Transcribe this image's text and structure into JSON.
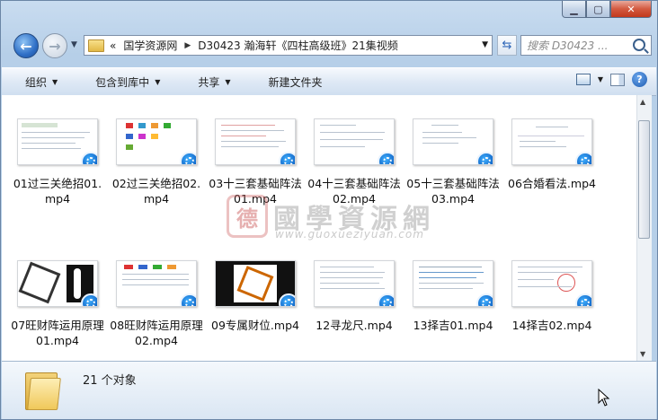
{
  "window": {
    "controls": {
      "minimize_icon": "minimize-icon",
      "maximize_icon": "maximize-icon",
      "close_icon": "close-icon"
    }
  },
  "nav": {
    "breadcrumb_overflow": "«",
    "breadcrumb": [
      "国学资源网",
      "D30423 瀚海轩《四柱高级班》21集视频"
    ],
    "search_placeholder": "搜索 D30423 ..."
  },
  "toolbar": {
    "organize": "组织",
    "include_in_library": "包含到库中",
    "share": "共享",
    "new_folder": "新建文件夹"
  },
  "files": [
    {
      "name": "01过三关绝招01.mp4"
    },
    {
      "name": "02过三关绝招02.mp4"
    },
    {
      "name": "03十三套基础阵法01.mp4"
    },
    {
      "name": "04十三套基础阵法02.mp4"
    },
    {
      "name": "05十三套基础阵法03.mp4"
    },
    {
      "name": "06合婚看法.mp4"
    },
    {
      "name": "07旺财阵运用原理01.mp4"
    },
    {
      "name": "08旺财阵运用原理02.mp4"
    },
    {
      "name": "09专属财位.mp4"
    },
    {
      "name": "12寻龙尺.mp4"
    },
    {
      "name": "13择吉01.mp4"
    },
    {
      "name": "14择吉02.mp4"
    }
  ],
  "watermark": {
    "seal": "德",
    "text": "國學資源網",
    "url": "www.guoxueziyuan.com"
  },
  "status": {
    "count": "21 个对象"
  }
}
